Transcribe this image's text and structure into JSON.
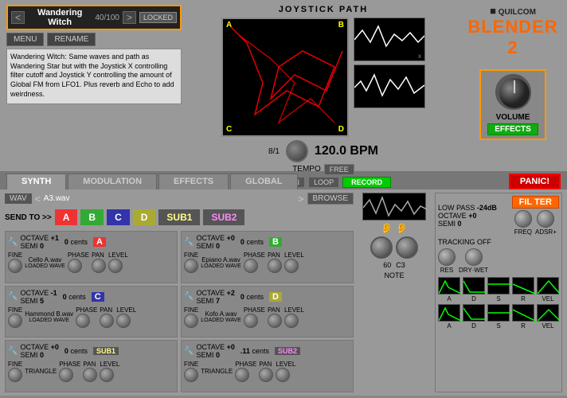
{
  "app": {
    "brand": "QUILCOM",
    "title": "BLENDER 2"
  },
  "preset": {
    "name": "Wandering Witch",
    "num": "40/100",
    "status": "LOCKED",
    "description": "Wandering Witch: Same waves and path as Wandering Star but with the Joystick X controlling filter cutoff and Joystick Y controlling the amount of Global FM from LFO1. Plus reverb and Echo to add weirdness."
  },
  "menu": {
    "menu_label": "MENU",
    "rename_label": "RENAME"
  },
  "joystick": {
    "title": "JOYSTICK PATH",
    "corners": {
      "a": "A",
      "b": "B",
      "c": "C",
      "d": "D"
    }
  },
  "tempo": {
    "bpm": "120.0 BPM",
    "division": "8/1",
    "mode_free": "FREE",
    "label": "TEMPO",
    "as_drawn": "AS DRAWN",
    "loop": "LOOP",
    "record": "RECORD"
  },
  "volume": {
    "label": "VOLUME",
    "effects_label": "EFFECTS"
  },
  "tabs": {
    "synth": "SYNTH",
    "modulation": "MODULATION",
    "effects": "EFFECTS",
    "global": "GLOBAL",
    "panic": "PANIC!"
  },
  "wav_selector": {
    "type": "WAV",
    "filename": "A3.wav",
    "browse": "BROWSE"
  },
  "send_to": {
    "label": "SEND TO >>",
    "channels": [
      "A",
      "B",
      "C",
      "D",
      "SUB1",
      "SUB2"
    ]
  },
  "note": {
    "num": "60",
    "note": "C3",
    "label": "NOTE"
  },
  "filter": {
    "header_label": "FIL TER",
    "low_pass": "LOW PASS",
    "low_pass_val": "-24dB",
    "octave_label": "OCTAVE",
    "octave_val": "+0",
    "semi_label": "SEMI",
    "semi_val": "0",
    "tracking": "TRACKING OFF",
    "freq_label": "FREQ",
    "adsr_label": "ADSR+",
    "res_label": "RES",
    "dry_wet_label": "DRY·WET",
    "adsr_keys": [
      "A",
      "D",
      "S",
      "R",
      "VEL"
    ]
  },
  "oscillators": [
    {
      "id": "osc-a",
      "octave_label": "OCTAVE",
      "octave_val": "+1",
      "semi_label": "SEMI",
      "semi_val": "0",
      "cents_label": "cents",
      "cents_val": "0",
      "fine_label": "FINE",
      "file": "Cello A.wav",
      "channel": "A",
      "ch_color": "#e33",
      "phase_label": "PHASE",
      "pan_label": "PAN",
      "level_label": "LEVEL"
    },
    {
      "id": "osc-b",
      "octave_label": "OCTAVE",
      "octave_val": "+0",
      "semi_label": "SEMI",
      "semi_val": "0",
      "cents_label": "cents",
      "cents_val": "0",
      "fine_label": "FINE",
      "file": "Epiano A.wav",
      "channel": "B",
      "ch_color": "#3a3",
      "phase_label": "PHASE",
      "pan_label": "PAN",
      "level_label": "LEVEL"
    },
    {
      "id": "osc-c",
      "octave_label": "OCTAVE",
      "octave_val": "-1",
      "semi_label": "SEMI",
      "semi_val": "5",
      "cents_label": "cents",
      "cents_val": "0",
      "fine_label": "FINE",
      "file": "Hammond B.wav",
      "channel": "C",
      "ch_color": "#33a",
      "phase_label": "PHASE",
      "pan_label": "PAN",
      "level_label": "LEVEL"
    },
    {
      "id": "osc-d",
      "octave_label": "OCTAVE",
      "octave_val": "+2",
      "semi_label": "SEMI",
      "semi_val": "7",
      "cents_label": "cents",
      "cents_val": "0",
      "fine_label": "FINE",
      "file": "Kofo A.wav",
      "channel": "D",
      "ch_color": "#aa3",
      "phase_label": "PHASE",
      "pan_label": "PAN",
      "level_label": "LEVEL"
    },
    {
      "id": "osc-sub1",
      "octave_label": "OCTAVE",
      "octave_val": "+0",
      "semi_label": "SEMI",
      "semi_val": "0",
      "cents_label": "cents",
      "cents_val": "0",
      "fine_label": "FINE",
      "file": "TRIANGLE",
      "channel": "SUB1",
      "ch_color": "#555",
      "phase_label": "PHASE",
      "pan_label": "PAN",
      "level_label": "LEVEL"
    },
    {
      "id": "osc-sub2",
      "octave_label": "OCTAVE",
      "octave_val": "+0",
      "semi_label": "SEMI",
      "semi_val": "0",
      "cents_label": "cents",
      "cents_val": ".11",
      "fine_label": "FINE",
      "file": "TRIANGLE",
      "channel": "SUB2",
      "ch_color": "#555",
      "phase_label": "PHASE",
      "pan_label": "PAN",
      "level_label": "LEVEL"
    }
  ]
}
